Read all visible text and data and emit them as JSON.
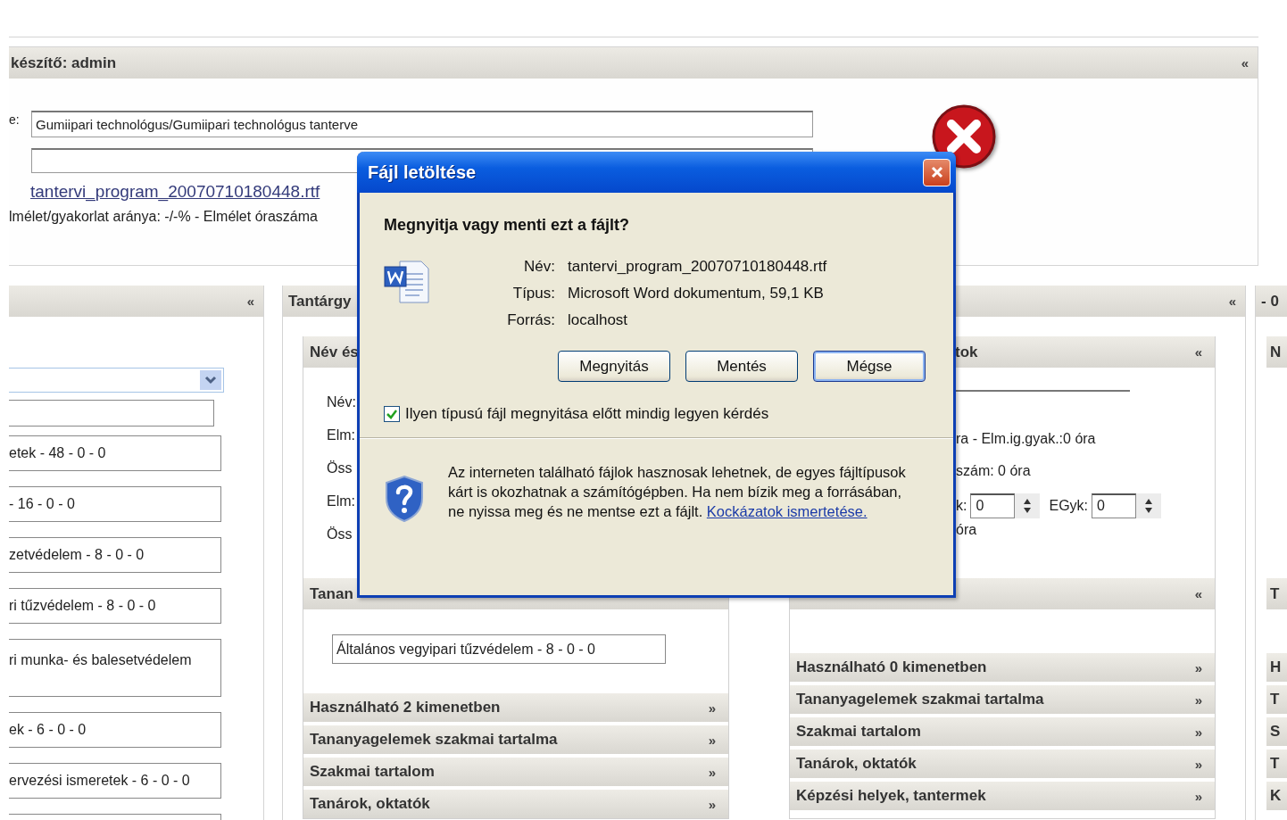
{
  "top_panel": {
    "title": "készítő: admin",
    "collapse": "«",
    "field_label": "e:",
    "name_value": "Gumiipari technológus/Gumiipari technológus tanterve",
    "file_link": "tantervi_program_20070710180448.rtf",
    "summary": "lmélet/gyakorlat aránya: -/-% - Elmélet óraszáma"
  },
  "left_panel": {
    "collapse": "«",
    "items": [
      {
        "text": "etek - 48 - 0 - 0",
        "tall": false
      },
      {
        "text": "- 16 - 0 - 0",
        "tall": false
      },
      {
        "text": "zetvédelem - 8 - 0 - 0",
        "tall": false
      },
      {
        "text": "ri tűzvédelem - 8 - 0 - 0",
        "tall": false
      },
      {
        "text": "ri munka- és balesetvédelem",
        "tall": true
      },
      {
        "text": "ek - 6 - 0 - 0",
        "tall": false
      },
      {
        "text": "ervezési ismeretek - 6 - 0 - 0",
        "tall": false
      },
      {
        "tall": false
      }
    ]
  },
  "subject_panel": {
    "title": "Tantárgy",
    "collapse": "«",
    "name_section": {
      "title": "Név és",
      "labels": [
        "Név:",
        "Elm:",
        "Öss",
        "Elm:",
        "Öss"
      ]
    },
    "material_section": {
      "title": "Tanan",
      "item": "Általános vegyipari tűzvédelem - 8 - 0 - 0"
    },
    "left_sections": [
      {
        "title": "Használható 2 kimenetben",
        "expander": "»"
      },
      {
        "title": "Tananyagelemek szakmai tartalma",
        "expander": "»"
      },
      {
        "title": "Szakmai tartalom",
        "expander": "»"
      },
      {
        "title": "Tanárok, oktatók",
        "expander": "»"
      }
    ],
    "data_section": {
      "title": "tok",
      "collapse": "«",
      "lines": [
        "ra - Elm.ig.gyak.:0 óra",
        "szám: 0 óra"
      ],
      "spin_label_1": "k:",
      "spin_value_1": "0",
      "spin_label_2": "EGyk:",
      "spin_value_2": "0",
      "total": "óra"
    },
    "second_section": {
      "collapse": "«"
    },
    "right_sections": [
      {
        "title": "Használható 0 kimenetben",
        "expander": "»"
      },
      {
        "title": "Tananyagelemek szakmai tartalma",
        "expander": "»"
      },
      {
        "title": "Szakmai tartalom",
        "expander": "»"
      },
      {
        "title": "Tanárok, oktatók",
        "expander": "»"
      },
      {
        "title": "Képzési helyek, tantermek",
        "expander": "»"
      }
    ]
  },
  "far_panel": {
    "title": "- 0",
    "upper_letters": [
      "N",
      "T"
    ],
    "letters": [
      "H",
      "T",
      "S",
      "T",
      "K"
    ]
  },
  "dialog": {
    "title": "Fájl letöltése",
    "question": "Megnyitja vagy menti ezt a fájlt?",
    "fields": [
      {
        "label": "Név:",
        "value": "tantervi_program_20070710180448.rtf"
      },
      {
        "label": "Típus:",
        "value": "Microsoft Word dokumentum, 59,1 KB"
      },
      {
        "label": "Forrás:",
        "value": "localhost"
      }
    ],
    "buttons": [
      {
        "label": "Megnyitás",
        "selected": false
      },
      {
        "label": "Mentés",
        "selected": false
      },
      {
        "label": "Mégse",
        "selected": true
      }
    ],
    "always_ask": {
      "label": "Ilyen típusú fájl megnyitása előtt mindig legyen kérdés",
      "checked": true
    },
    "warning": "Az interneten található fájlok hasznosak lehetnek, de egyes fájltípusok kárt is okozhatnak a számítógépben. Ha nem bízik meg a forrásában, ne nyissa meg és ne mentse ezt a fájlt.",
    "warning_link": "Kockázatok ismertetése."
  }
}
